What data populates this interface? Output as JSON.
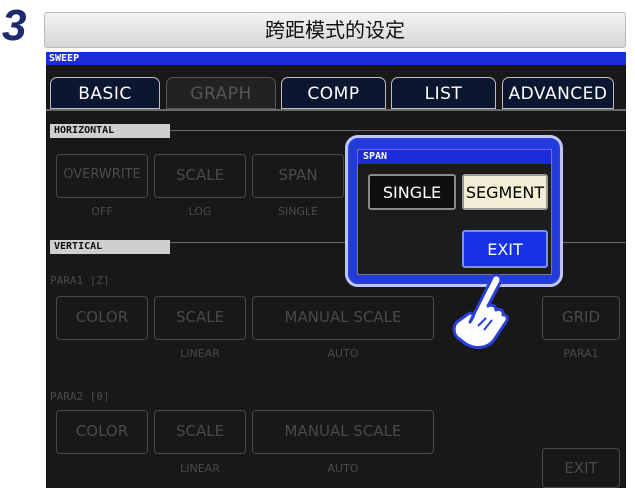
{
  "step_number": "3",
  "title": "跨距模式的设定",
  "sweep_label": "SWEEP",
  "tabs": [
    {
      "label": "BASIC",
      "active": false
    },
    {
      "label": "GRAPH",
      "active": true
    },
    {
      "label": "COMP",
      "active": false
    },
    {
      "label": "LIST",
      "active": false
    },
    {
      "label": "ADVANCED",
      "active": false
    }
  ],
  "horizontal": {
    "label": "HORIZONTAL",
    "overwrite": {
      "label": "OVERWRITE",
      "value": "OFF"
    },
    "scale": {
      "label": "SCALE",
      "value": "LOG"
    },
    "span": {
      "label": "SPAN",
      "value": "SINGLE"
    }
  },
  "vertical": {
    "label": "VERTICAL",
    "para1": {
      "label": "PARA1 [Z]",
      "color": "COLOR",
      "scale": {
        "label": "SCALE",
        "value": "LINEAR"
      },
      "manual_scale": {
        "label": "MANUAL SCALE",
        "value": "AUTO"
      },
      "grid": {
        "label": "GRID",
        "value": "PARA1"
      }
    },
    "para2": {
      "label": "PARA2 [θ]",
      "color": "COLOR",
      "scale": {
        "label": "SCALE",
        "value": "LINEAR"
      },
      "manual_scale": {
        "label": "MANUAL SCALE",
        "value": "AUTO"
      }
    }
  },
  "exit_label": "EXIT",
  "span_dialog": {
    "title": "SPAN",
    "single_label": "SINGLE",
    "segment_label": "SEGMENT",
    "exit_label": "EXIT"
  },
  "colors": {
    "accent_blue": "#1b2dd8",
    "segment_selected": "#f3eed5"
  }
}
